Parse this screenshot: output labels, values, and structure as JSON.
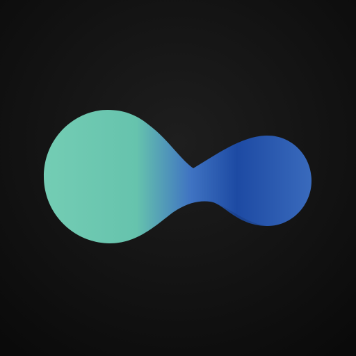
{
  "app_icon": {
    "logo_name": "infinity-logo-icon",
    "colors": {
      "background_center": "#1e1e1e",
      "background_edge": "#0a0a0a",
      "logo_teal": "#66c3ad",
      "logo_teal_light": "#74cdb4",
      "logo_mid_blue": "#3f73c2",
      "logo_deep_blue": "#1d4aa3",
      "logo_blue_light": "#3a6bbd"
    }
  }
}
